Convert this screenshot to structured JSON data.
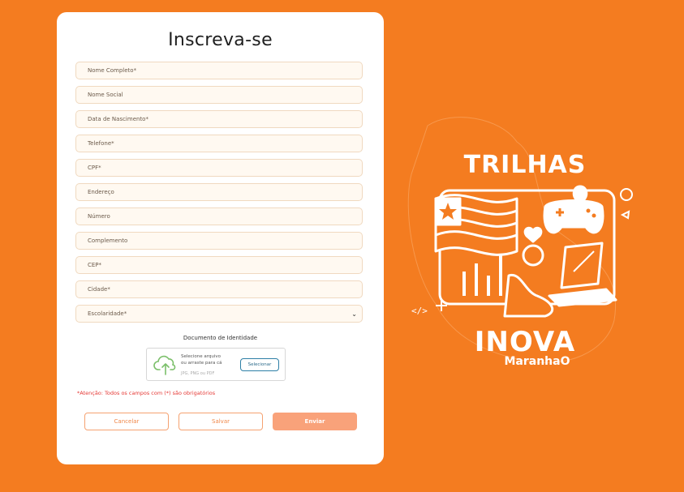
{
  "form": {
    "title": "Inscreva-se",
    "fields": [
      {
        "label": "Nome Completo*"
      },
      {
        "label": "Nome Social"
      },
      {
        "label": "Data de Nascimento*"
      },
      {
        "label": "Telefone*"
      },
      {
        "label": "CPF*"
      },
      {
        "label": "Endereço"
      },
      {
        "label": "Número"
      },
      {
        "label": "Complemento"
      },
      {
        "label": "CEP*"
      },
      {
        "label": "Cidade*"
      }
    ],
    "escolaridade": {
      "selected": "Escolaridade*"
    },
    "document": {
      "label": "Documento de Identidade",
      "upload_text_1": "Selecione arquivo",
      "upload_text_2": "ou arraste para cá",
      "formats": "JPG, PNG ou PDF",
      "select_button": "Selecionar"
    },
    "warning": "*Atenção: Todos os campos com (*) são obrigatórios",
    "buttons": {
      "cancel": "Cancelar",
      "save": "Salvar",
      "send": "Enviar"
    }
  },
  "brand": {
    "title": "TRILHAS",
    "logo_main": "INOVA",
    "logo_sub": "MaranhaO"
  },
  "colors": {
    "background": "#f47c20",
    "field_bg": "#fff9f1",
    "warning": "#e53935",
    "send_button": "#f9a27a"
  }
}
